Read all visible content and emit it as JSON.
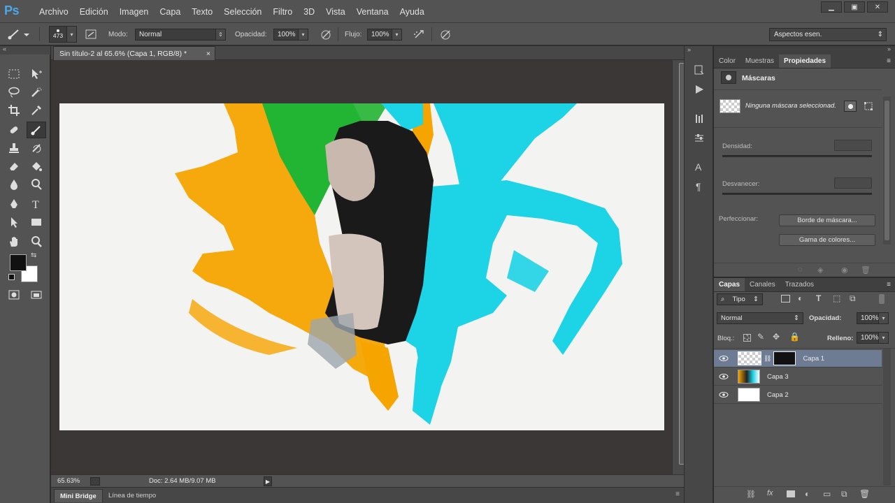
{
  "app": {
    "logo": "Ps",
    "menu": [
      "Archivo",
      "Edición",
      "Imagen",
      "Capa",
      "Texto",
      "Selección",
      "Filtro",
      "3D",
      "Vista",
      "Ventana",
      "Ayuda"
    ],
    "window_controls": [
      "▁",
      "▣",
      "✕"
    ]
  },
  "options": {
    "brush_size": "473",
    "mode_label": "Modo:",
    "mode_value": "Normal",
    "opacity_label": "Opacidad:",
    "opacity_value": "100%",
    "flow_label": "Flujo:",
    "flow_value": "100%",
    "workspace": "Aspectos esen."
  },
  "document": {
    "tab_title": "Sin título-2 al 65.6% (Capa 1, RGB/8) *",
    "tab_close": "×",
    "zoom": "65.63%",
    "doc_info": "Doc: 2.64 MB/9.07 MB",
    "bottom_tabs": [
      "Mini Bridge",
      "Línea de tiempo"
    ]
  },
  "properties": {
    "tabs": [
      "Color",
      "Muestras",
      "Propiedades"
    ],
    "title": "Máscaras",
    "mask_status": "Ninguna máscara seleccionad.",
    "density_label": "Densidad:",
    "feather_label": "Desvanecer:",
    "refine_label": "Perfeccionar:",
    "mask_edge_button": "Borde de máscara...",
    "color_range_button": "Gama de colores..."
  },
  "layers": {
    "tabs": [
      "Capas",
      "Canales",
      "Trazados"
    ],
    "filter": "Tipo",
    "blend_mode": "Normal",
    "opacity_label": "Opacidad:",
    "opacity_value": "100%",
    "lock_label": "Bloq.:",
    "fill_label": "Relleno:",
    "fill_value": "100%",
    "items": [
      {
        "name": "Capa 1"
      },
      {
        "name": "Capa 3"
      },
      {
        "name": "Capa 2"
      }
    ]
  },
  "colors": {
    "accent_blue": "#4aa8e8",
    "orange": "#f6a400",
    "green": "#22b533",
    "cyan": "#1dd3e6",
    "selected_layer": "#6d7c92"
  }
}
